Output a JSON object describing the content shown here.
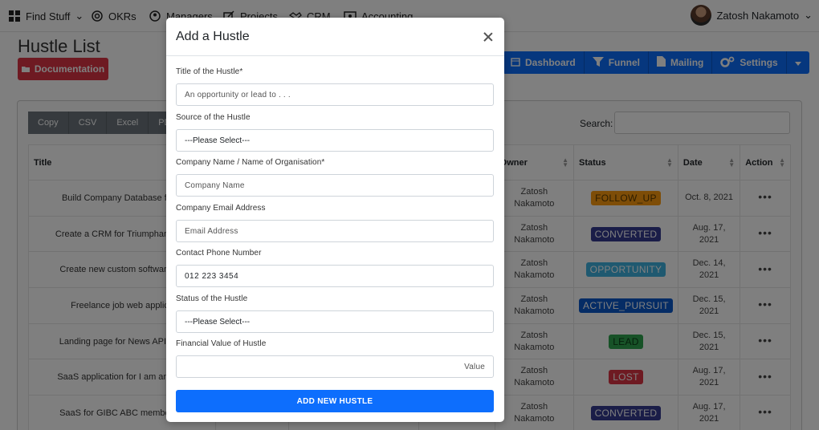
{
  "nav": {
    "items": [
      {
        "label": "Find Stuff",
        "icon": "grid-icon"
      },
      {
        "label": "OKRs",
        "icon": "target-icon"
      },
      {
        "label": "Managers",
        "icon": "user-circle-icon"
      },
      {
        "label": "Projects",
        "icon": "edit-icon"
      },
      {
        "label": "CRM",
        "icon": "handshake-icon"
      },
      {
        "label": "Accounting",
        "icon": "cash-icon"
      }
    ],
    "user_name": "Zatosh Nakamoto"
  },
  "page": {
    "title": "Hustle List",
    "documentation_label": "Documentation"
  },
  "toolbar": {
    "dashboard": "Dashboard",
    "funnel": "Funnel",
    "mailing": "Mailing",
    "settings": "Settings"
  },
  "exports": [
    "Copy",
    "CSV",
    "Excel",
    "PDF"
  ],
  "search": {
    "label": "Search:"
  },
  "table": {
    "headers": {
      "title": "Title",
      "owner": "Owner",
      "status": "Status",
      "date": "Date",
      "action": "Action"
    },
    "rows": [
      {
        "title": "Build Company Database for T",
        "owner1": "Zatosh",
        "owner2": "Nakamoto",
        "status": "FOLLOW_UP",
        "status_color": "#fd9b0f",
        "status_text": "#5a3a00",
        "date1": "Oct. 8, 2021",
        "date2": ""
      },
      {
        "title": "Create a CRM for Triumphant Zoe",
        "owner1": "Zatosh",
        "owner2": "Nakamoto",
        "status": "CONVERTED",
        "status_color": "#343a90",
        "status_text": "#ffffff",
        "date1": "Aug. 17,",
        "date2": "2021"
      },
      {
        "title": "Create new custom software for",
        "owner1": "Zatosh",
        "owner2": "Nakamoto",
        "status": "OPPORTUNITY",
        "status_color": "#3fb2e0",
        "status_text": "#ffffff",
        "date1": "Dec. 14,",
        "date2": "2021"
      },
      {
        "title": "Freelance job web applica",
        "owner1": "Zatosh",
        "owner2": "Nakamoto",
        "status": "ACTIVE_PURSUIT",
        "status_color": "#0a58ca",
        "status_text": "#ffffff",
        "date1": "Dec. 15,",
        "date2": "2021"
      },
      {
        "title": "Landing page for News API new",
        "owner1": "Zatosh",
        "owner2": "Nakamoto",
        "status": "LEAD",
        "status_color": "#2ea44f",
        "status_text": "#0b3d16",
        "date1": "Dec. 15,",
        "date2": "2021"
      },
      {
        "title": "SaaS application for I am an Entr",
        "owner1": "Zatosh",
        "owner2": "Nakamoto",
        "status": "LOST",
        "status_color": "#dc3545",
        "status_text": "#ffffff",
        "date1": "Aug. 17,",
        "date2": "2021"
      },
      {
        "title": "SaaS for GIBC ABC members d",
        "owner1": "Zatosh",
        "owner2": "Nakamoto",
        "status": "CONVERTED",
        "status_color": "#343a90",
        "status_text": "#ffffff",
        "date1": "Aug. 17,",
        "date2": "2021"
      }
    ],
    "action_glyph": "•••"
  },
  "modal": {
    "title": "Add a Hustle",
    "fields": {
      "title": {
        "label": "Title of the Hustle*",
        "placeholder": "An opportunity or lead to  . . ."
      },
      "source": {
        "label": "Source of the Hustle",
        "value": "---Please Select---"
      },
      "company": {
        "label": "Company Name / Name of Organisation*",
        "placeholder": "Company Name"
      },
      "email": {
        "label": "Company Email Address",
        "placeholder": "Email Address"
      },
      "phone": {
        "label": "Contact Phone Number",
        "value": "012 223 3454"
      },
      "status": {
        "label": "Status of the Hustle",
        "value": "---Please Select---"
      },
      "value": {
        "label": "Financial Value of Hustle",
        "placeholder": "Value"
      }
    },
    "submit_label": "ADD NEW HUSTLE"
  },
  "colors": {
    "primary": "#0d6efd",
    "danger": "#dc3545",
    "secondary": "#6c757d"
  }
}
